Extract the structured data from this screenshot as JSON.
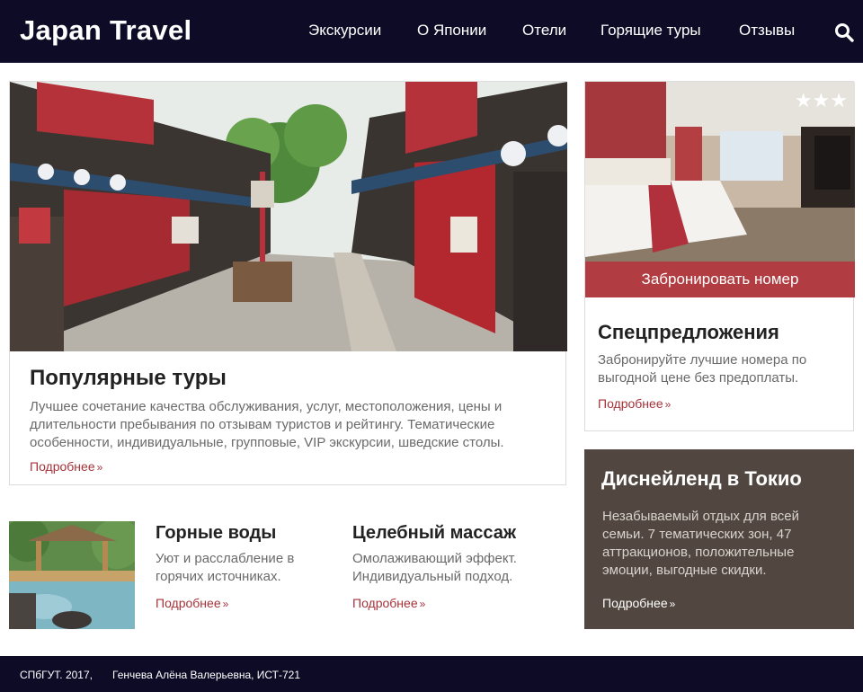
{
  "header": {
    "brand": "Japan Travel",
    "nav": [
      "Экскурсии",
      "О Японии",
      "Отели",
      "Горящие туры",
      "Отзывы"
    ]
  },
  "hero": {
    "title": "Популярные туры",
    "text": "Лучшее сочетание качества обслуживания, услуг, местоположения, цены и длительности пребывания по отзывам туристов и рейтингу. Тематические особенности, индивидуальные, групповые, VIP экскурсии, шведские столы.",
    "more": "Подробнее"
  },
  "hotel": {
    "stars": "★★★",
    "rating": 3,
    "button": "Забронировать номер",
    "title": "Спецпредложения",
    "text": "Забронируйте лучшие номера по выгодной цене без предоплаты.",
    "more": "Подробнее"
  },
  "disney": {
    "title": "Диснейленд в Токио",
    "text": "Незабываемый отдых для всей семьи. 7 тематических зон, 47 аттракционов, положительные эмоции, выгодные скидки.",
    "more": "Подробнее"
  },
  "items": [
    {
      "title": "Горные воды",
      "text": "Уют и расслабление в горячих источниках.",
      "more": "Подробнее"
    },
    {
      "title": "Целебный массаж",
      "text": "Омолаживающий эффект. Индивидуальный подход.",
      "more": "Подробнее"
    }
  ],
  "footer": {
    "org": "СПбГУТ. 2017,",
    "author": "Генчева Алёна Валерьевна, ИСТ-721"
  },
  "colors": {
    "header_bg": "#0e0b26",
    "accent": "#b13c41",
    "disney_bg": "#514740"
  },
  "icons": [
    "search-icon",
    "chevron-right-icon",
    "star-icon"
  ]
}
